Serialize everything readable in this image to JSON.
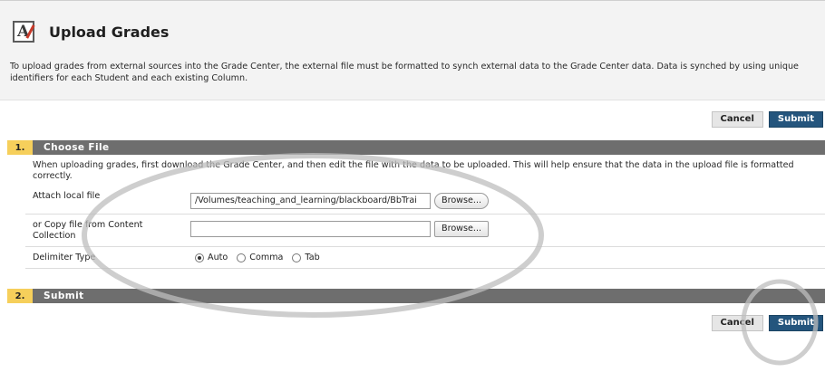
{
  "header": {
    "title": "Upload Grades",
    "icon": "grade-upload-icon",
    "intro": "To upload grades from external sources into the Grade Center, the external file must be formatted to synch external data to the Grade Center data. Data is synched by using unique identifiers for each Student and each existing Column."
  },
  "buttons": {
    "cancel": "Cancel",
    "submit": "Submit"
  },
  "steps": [
    {
      "number": "1.",
      "title": "Choose File"
    },
    {
      "number": "2.",
      "title": "Submit"
    }
  ],
  "choose_file": {
    "instruction": "When uploading grades, first download the Grade Center, and then edit the file with the data to be uploaded. This will help ensure that the data in the upload file is formatted correctly.",
    "attach_label": "Attach local file",
    "attach_value": "/Volumes/teaching_and_learning/blackboard/BbTrai",
    "browse_label": "Browse...",
    "copy_label": "or Copy file from Content Collection",
    "copy_value": "",
    "delimiter_label": "Delimiter Type",
    "delimiter_options": [
      "Auto",
      "Comma",
      "Tab"
    ],
    "delimiter_selected": "Auto"
  },
  "colors": {
    "step_bar": "#6e6e6e",
    "step_number": "#f6cf5b",
    "submit_button": "#24557d",
    "header_bg": "#f3f3f3"
  }
}
